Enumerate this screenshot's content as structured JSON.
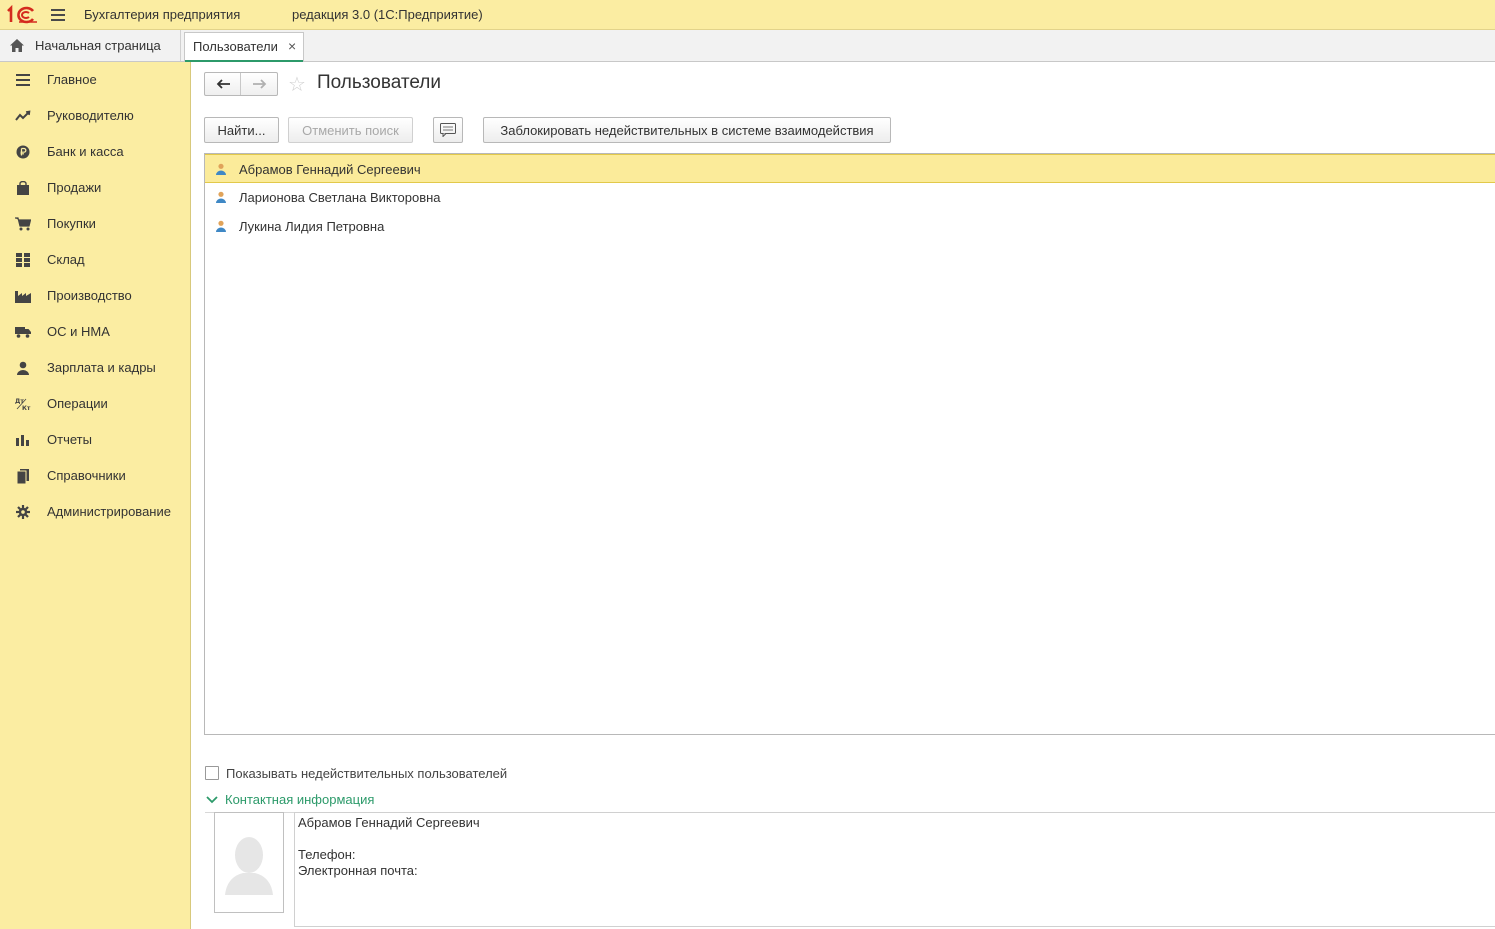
{
  "app": {
    "title": "Бухгалтерия предприятия",
    "edition": "редакция 3.0  (1С:Предприятие)",
    "accent_color": "#fbeda2",
    "link_color": "#2c9a6a"
  },
  "tabs": {
    "home_label": "Начальная страница",
    "active_label": "Пользователи",
    "close_symbol": "×"
  },
  "sidebar": {
    "items": [
      {
        "label": "Главное",
        "icon": "menu-lines-icon"
      },
      {
        "label": "Руководителю",
        "icon": "trend-icon"
      },
      {
        "label": "Банк и касса",
        "icon": "ruble-coin-icon"
      },
      {
        "label": "Продажи",
        "icon": "shopping-bag-icon"
      },
      {
        "label": "Покупки",
        "icon": "cart-icon"
      },
      {
        "label": "Склад",
        "icon": "warehouse-grid-icon"
      },
      {
        "label": "Производство",
        "icon": "factory-icon"
      },
      {
        "label": "ОС и НМА",
        "icon": "truck-icon"
      },
      {
        "label": "Зарплата и кадры",
        "icon": "person-icon"
      },
      {
        "label": "Операции",
        "icon": "dt-kt-icon"
      },
      {
        "label": "Отчеты",
        "icon": "bar-chart-icon"
      },
      {
        "label": "Справочники",
        "icon": "books-icon"
      },
      {
        "label": "Администрирование",
        "icon": "gear-icon"
      }
    ]
  },
  "page": {
    "title": "Пользователи"
  },
  "toolbar": {
    "find_label": "Найти...",
    "cancel_search_label": "Отменить поиск",
    "block_label": "Заблокировать недействительных в системе взаимодействия"
  },
  "users": [
    {
      "name": "Абрамов Геннадий Сергеевич",
      "selected": true
    },
    {
      "name": "Ларионова Светлана Викторовна",
      "selected": false
    },
    {
      "name": "Лукина Лидия Петровна",
      "selected": false
    }
  ],
  "options": {
    "show_invalid_label": "Показывать недействительных пользователей",
    "show_invalid_checked": false
  },
  "contact": {
    "group_label": "Контактная информация",
    "name": "Абрамов Геннадий Сергеевич",
    "phone_label": "Телефон:",
    "email_label": "Электронная почта:"
  }
}
